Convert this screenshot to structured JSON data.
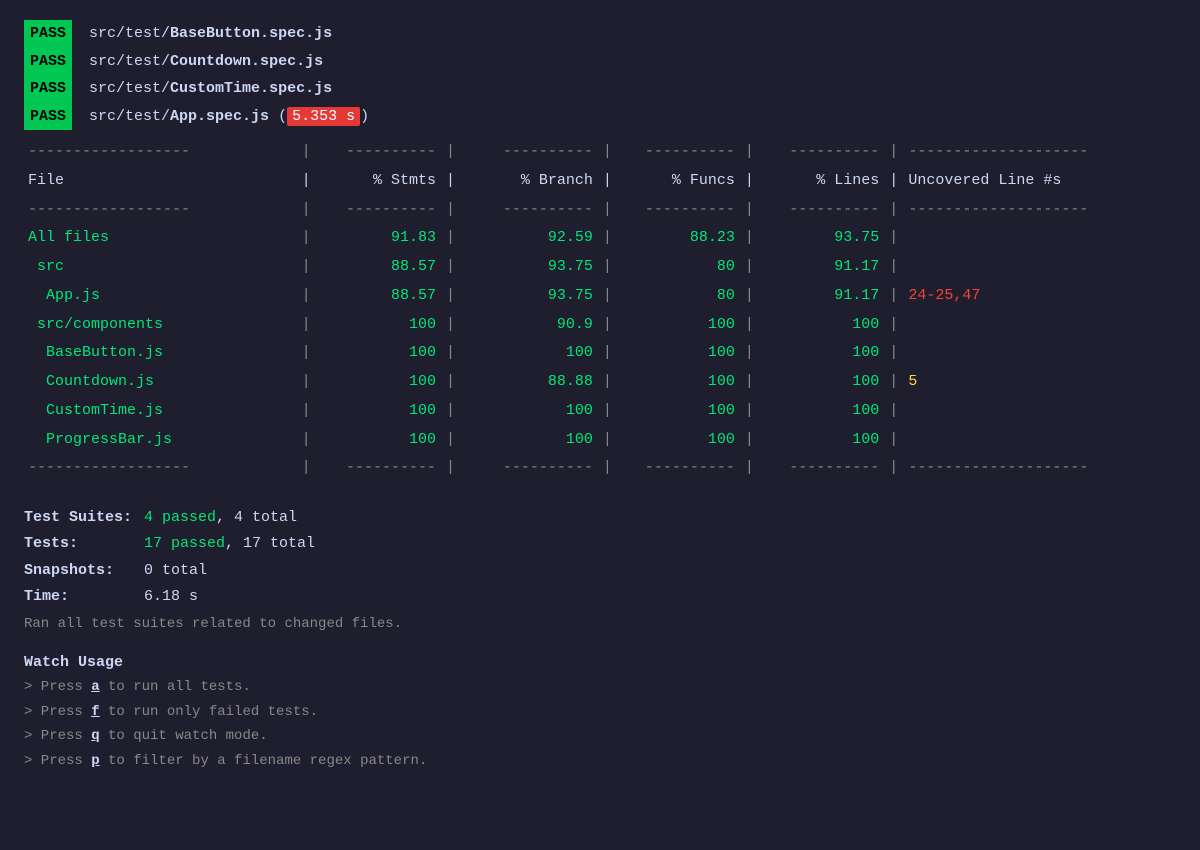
{
  "pass_lines": [
    {
      "id": "pass1",
      "badge": "PASS",
      "file": "src/test/",
      "file_bold": "BaseButton.spec.js",
      "time": null
    },
    {
      "id": "pass2",
      "badge": "PASS",
      "file": "src/test/",
      "file_bold": "Countdown.spec.js",
      "time": null
    },
    {
      "id": "pass3",
      "badge": "PASS",
      "file": "src/test/",
      "file_bold": "CustomTime.spec.js",
      "time": null
    },
    {
      "id": "pass4",
      "badge": "PASS",
      "file": "src/test/",
      "file_bold": "App.spec.js",
      "time": "5.353 s"
    }
  ],
  "table": {
    "header": {
      "file": "File",
      "stmts": "% Stmts",
      "branch": "% Branch",
      "funcs": "% Funcs",
      "lines": "% Lines",
      "uncovered": "Uncovered Line #s"
    },
    "rows": [
      {
        "file": "All files",
        "indent": 0,
        "stmts": "91.83",
        "branch": "92.59",
        "funcs": "88.23",
        "lines": "93.75",
        "uncovered": "",
        "color": "green"
      },
      {
        "file": "src",
        "indent": 1,
        "stmts": "88.57",
        "branch": "93.75",
        "funcs": "80",
        "lines": "91.17",
        "uncovered": "",
        "color": "green"
      },
      {
        "file": "App.js",
        "indent": 2,
        "stmts": "88.57",
        "branch": "93.75",
        "funcs": "80",
        "lines": "91.17",
        "uncovered": "24-25,47",
        "color": "green",
        "uncovered_color": "red"
      },
      {
        "file": "src/components",
        "indent": 1,
        "stmts": "100",
        "branch": "90.9",
        "funcs": "100",
        "lines": "100",
        "uncovered": "",
        "color": "green"
      },
      {
        "file": "BaseButton.js",
        "indent": 2,
        "stmts": "100",
        "branch": "100",
        "funcs": "100",
        "lines": "100",
        "uncovered": "",
        "color": "green"
      },
      {
        "file": "Countdown.js",
        "indent": 2,
        "stmts": "100",
        "branch": "88.88",
        "funcs": "100",
        "lines": "100",
        "uncovered": "5",
        "color": "green",
        "uncovered_color": "yellow"
      },
      {
        "file": "CustomTime.js",
        "indent": 2,
        "stmts": "100",
        "branch": "100",
        "funcs": "100",
        "lines": "100",
        "uncovered": "",
        "color": "green"
      },
      {
        "file": "ProgressBar.js",
        "indent": 2,
        "stmts": "100",
        "branch": "100",
        "funcs": "100",
        "lines": "100",
        "uncovered": "",
        "color": "green"
      }
    ]
  },
  "summary": {
    "test_suites_label": "Test Suites:",
    "test_suites_value": "4 passed, 4 total",
    "tests_label": "Tests:",
    "tests_value": "17 passed, 17 total",
    "snapshots_label": "Snapshots:",
    "snapshots_value": "0 total",
    "time_label": "Time:",
    "time_value": "6.18 s",
    "ran_line": "Ran all test suites related to changed files."
  },
  "watch": {
    "title": "Watch Usage",
    "items": [
      {
        "text": "Press ",
        "key": "a",
        "rest": " to run all tests."
      },
      {
        "text": "Press ",
        "key": "f",
        "rest": " to run only failed tests."
      },
      {
        "text": "Press ",
        "key": "q",
        "rest": " to quit watch mode."
      },
      {
        "text": "Press ",
        "key": "p",
        "rest": " to filter by a filename regex pattern."
      }
    ]
  }
}
